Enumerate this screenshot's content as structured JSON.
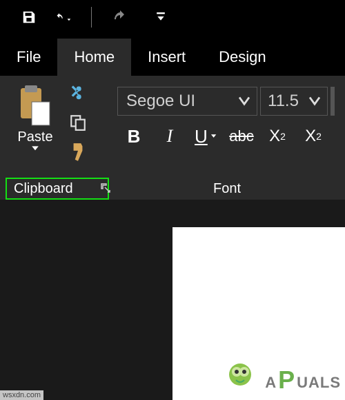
{
  "titlebar": {
    "save_icon": "save",
    "undo_icon": "undo",
    "redo_icon": "redo",
    "dropdown_icon": "chevron-down"
  },
  "tabs": {
    "file": "File",
    "home": "Home",
    "insert": "Insert",
    "design": "Design"
  },
  "ribbon": {
    "clipboard": {
      "paste_label": "Paste",
      "label": "Clipboard",
      "cut_icon": "cut",
      "copy_icon": "copy",
      "format_painter_icon": "format-painter",
      "launcher_icon": "dialog-launcher"
    },
    "font": {
      "name": "Segoe UI",
      "size": "11.5",
      "label": "Font",
      "bold": "B",
      "italic": "I",
      "underline": "U",
      "strike": "abc",
      "sub_base": "X",
      "sub_s": "2",
      "sup_base": "X",
      "sup_s": "2"
    }
  },
  "watermark": {
    "pre": "A",
    "mid": "P",
    "post": "UALS"
  },
  "source": "wsxdn.com",
  "highlight": {
    "color": "#14e014"
  }
}
